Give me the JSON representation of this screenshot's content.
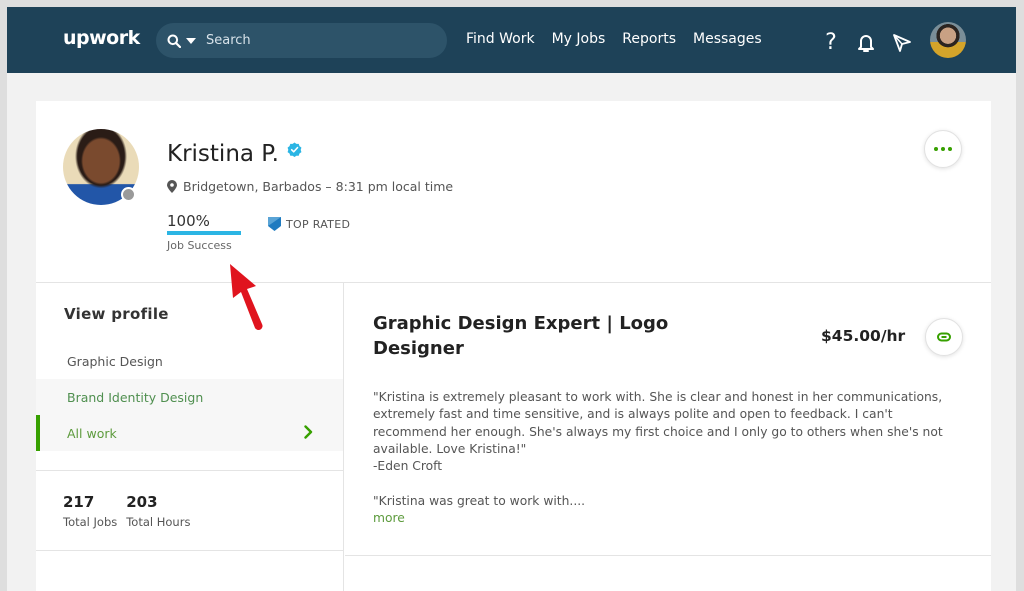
{
  "header": {
    "logo": "upwork",
    "search": {
      "placeholder": "Search",
      "value": ""
    },
    "nav": [
      "Find Work",
      "My Jobs",
      "Reports",
      "Messages"
    ],
    "icons": [
      "help-icon",
      "bell-icon",
      "send-icon",
      "user-avatar"
    ],
    "help_glyph": "?"
  },
  "profile": {
    "name": "Kristina P.",
    "verified": true,
    "location": "Bridgetown, Barbados – 8:31 pm local time",
    "job_success": {
      "value": "100%",
      "label": "Job Success",
      "fraction": 1.0
    },
    "badge": "TOP RATED",
    "status": "offline"
  },
  "sidebar": {
    "heading": "View profile",
    "items": [
      {
        "label": "Graphic Design",
        "state": "default"
      },
      {
        "label": "Brand Identity Design",
        "state": "hover"
      },
      {
        "label": "All work",
        "state": "selected"
      }
    ],
    "stats": [
      {
        "value": "217",
        "label": "Total Jobs"
      },
      {
        "value": "203",
        "label": "Total Hours"
      }
    ]
  },
  "main": {
    "title": "Graphic Design Expert | Logo Designer",
    "rate": "$45.00/hr",
    "review": "\"Kristina is extremely pleasant to work with. She is clear and honest in her communications, extremely fast and time sensitive, and is always polite and open to feedback. I can't recommend her enough. She's always my first choice and I only go to others when she's not available. Love Kristina!\"\n-Eden Croft\n\n\"Kristina was great to work with....",
    "more_label": "more"
  },
  "colors": {
    "header_bg": "#1e4258",
    "accent_green": "#37a000",
    "job_success_blue": "#2bb5e4",
    "annotation_red": "#e0141e"
  }
}
